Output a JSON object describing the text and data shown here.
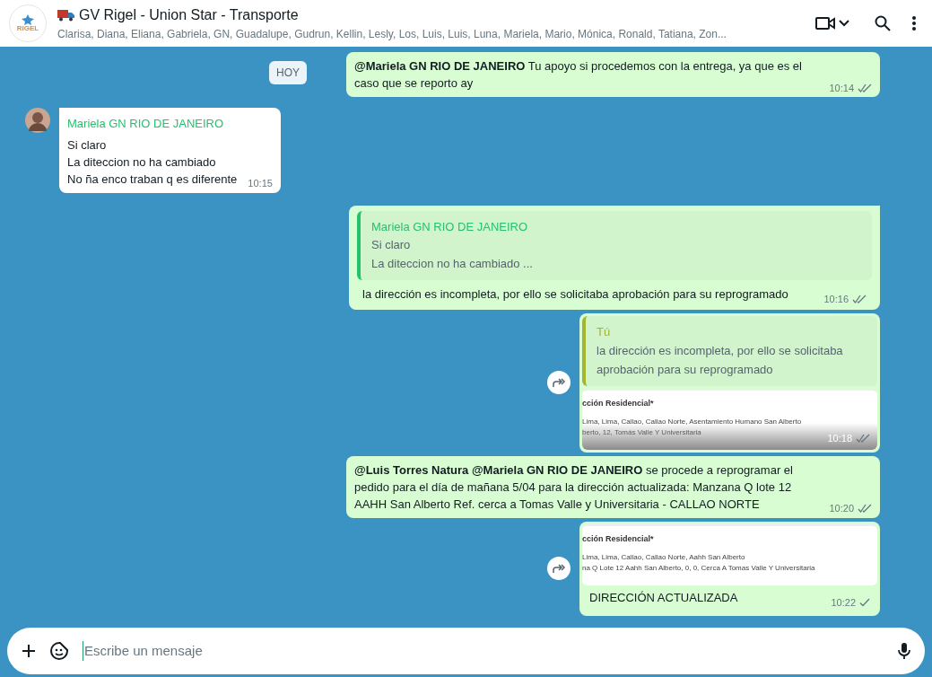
{
  "header": {
    "logo_text": "RIGEL",
    "title": "GV Rigel - Union Star - Transporte",
    "members": "Clarisa, Diana, Eliana, Gabriela, GN, Guadalupe, Gudrun, Kellin, Lesly, Los, Luis, Luis, Luna, Mariela, Mario, Mónica, Ronald, Tatiana, Zon..."
  },
  "date_chip": "HOY",
  "messages": [
    {
      "outgoing": true,
      "kind": "text",
      "text": "**@Mariela GN RIO DE JANEIRO** Tu apoyo si procedemos con la entrega, ya que es el caso que se reporto ay",
      "time": "10:14",
      "delivered": true
    },
    {
      "outgoing": false,
      "kind": "text",
      "sender": "Mariela GN RIO DE JANEIRO",
      "text": "Si claro\nLa diteccion no ha cambiado\nNo ña enco traban q es diferente",
      "time": "10:15"
    },
    {
      "outgoing": true,
      "kind": "reply",
      "quote": {
        "author": "Mariela GN RIO DE JANEIRO",
        "text": "Si claro\nLa diteccion no ha cambiado ...",
        "color": "#25c16f"
      },
      "text": "la dirección es incompleta, por ello se solicitaba aprobación para su reprogramado",
      "time": "10:16",
      "delivered": true
    },
    {
      "outgoing": true,
      "kind": "image",
      "forward": true,
      "quote": {
        "author": "Tú",
        "text": "la dirección es incompleta, por ello se solicitaba aprobación para su reprogramado",
        "color": "#a4b532"
      },
      "document": {
        "heading": "cción Residencial*",
        "lines": [
          "Lima, Lima, Callao, Callao Norte, Asentamiento Humano San Alberto",
          "berto, 12, Tomás Valle Y Universitaria"
        ]
      },
      "time": "10:18",
      "delivered": true
    },
    {
      "outgoing": true,
      "kind": "text",
      "text": "**@Luis Torres Natura** **@Mariela GN RIO DE JANEIRO** se procede a reprogramar el pedido para el día de mañana 5/04 para la dirección actualizada: Manzana Q lote 12 AAHH San Alberto Ref. cerca a Tomas Valle y Universitaria - CALLAO NORTE",
      "time": "10:20",
      "delivered": true
    },
    {
      "outgoing": true,
      "kind": "image",
      "forward": true,
      "document": {
        "heading": "cción Residencial*",
        "lines": [
          "Lima, Lima, Callao, Callao Norte, Aahh San Alberto",
          "na Q Lote 12 Aahh San Alberto, 0, 0, Cerca A Tomas Valle Y Universitaria"
        ]
      },
      "caption": "DIRECCIÓN ACTUALIZADA",
      "time": "10:22",
      "delivered": false
    }
  ],
  "composer": {
    "placeholder": "Escribe un mensaje"
  }
}
